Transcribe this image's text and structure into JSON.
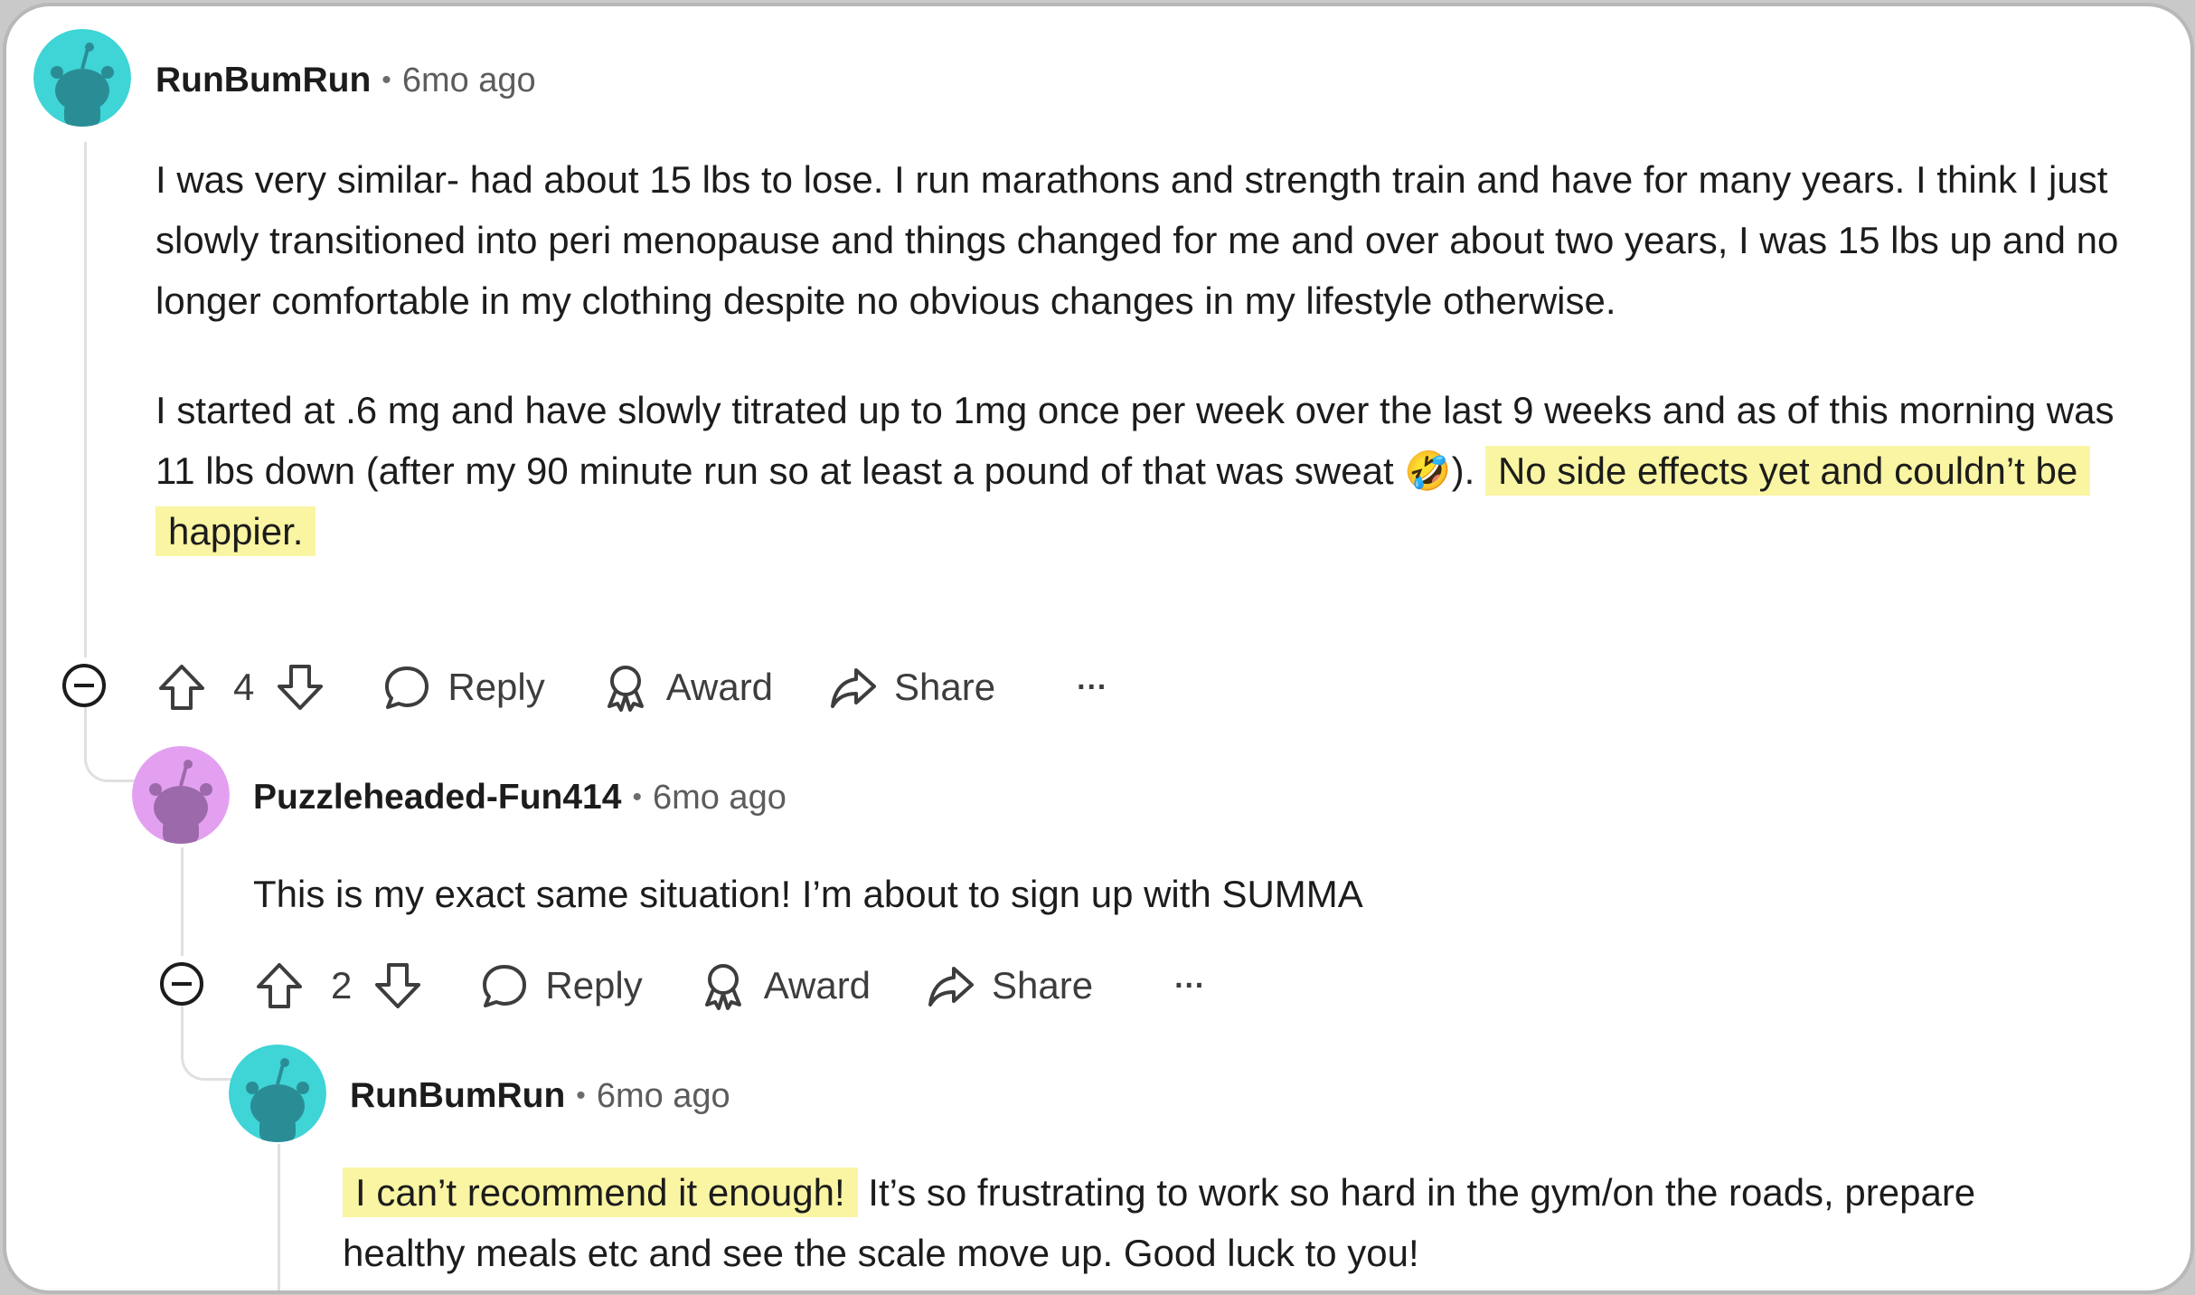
{
  "comments": [
    {
      "username": "RunBumRun",
      "separator": "•",
      "timestamp": "6mo ago",
      "avatar_color": "#3fd4d6",
      "paragraph1": "I was very similar- had about 15 lbs to lose. I run marathons and strength train and have for many years. I think I just slowly transitioned into peri menopause and things changed for me and over about two years, I was 15 lbs up and no longer comfortable in my clothing despite no obvious changes in my lifestyle otherwise.",
      "paragraph2_plain": "I started at .6 mg and have slowly titrated up to 1mg once per week over the last 9 weeks and as of this morning was 11 lbs down (after my 90 minute run so at least a pound of that was sweat ",
      "emoji": "🤣",
      "paragraph2_close": ").",
      "paragraph2_highlight": "No side effects yet and couldn’t be happier.",
      "vote_count": "4",
      "reply_label": "Reply",
      "award_label": "Award",
      "share_label": "Share",
      "more_label": "···"
    },
    {
      "username": "Puzzleheaded-Fun414",
      "separator": "•",
      "timestamp": "6mo ago",
      "avatar_color": "#e3a0f0",
      "body": "This is my exact same situation! I’m about to sign up with SUMMA",
      "vote_count": "2",
      "reply_label": "Reply",
      "award_label": "Award",
      "share_label": "Share",
      "more_label": "···"
    },
    {
      "username": "RunBumRun",
      "separator": "•",
      "timestamp": "6mo ago",
      "avatar_color": "#3fd4d6",
      "body_highlight": "I can’t recommend it enough!",
      "body_plain": " It’s so frustrating to work so hard in the gym/on the roads, prepare healthy meals etc and see the scale move up. Good luck to you!"
    }
  ],
  "colors": {
    "highlight": "#faf5a3",
    "thread_line": "#e0e0e0",
    "text": "#1c1c1c",
    "muted": "#5c5c5c"
  },
  "icons": [
    "collapse-icon",
    "upvote-icon",
    "downvote-icon",
    "reply-icon",
    "award-icon",
    "share-icon",
    "more-icon",
    "snoo-avatar-icon"
  ]
}
